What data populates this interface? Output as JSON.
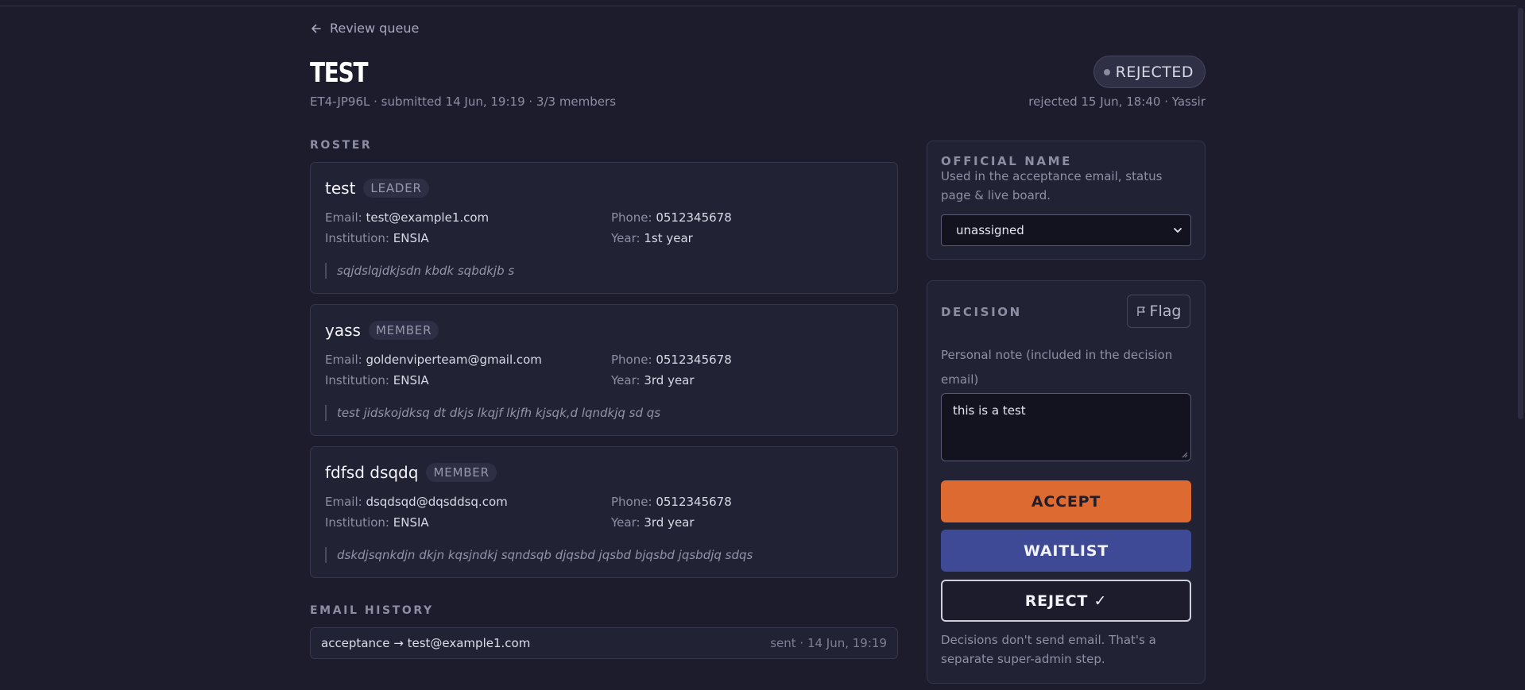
{
  "nav": {
    "back_label": "Review queue"
  },
  "team": {
    "name": "TEST",
    "meta": "ET4-JP96L · submitted 14 Jun, 19:19 · 3/3 members",
    "status": "REJECTED",
    "status_detail": "rejected 15 Jun, 18:40 · Yassir"
  },
  "roster": {
    "label": "ROSTER",
    "members": [
      {
        "name": "test",
        "role": "LEADER",
        "email": "test@example1.com",
        "phone": "0512345678",
        "institution": "ENSIA",
        "year": "1st year",
        "note": "sqjdslqjdkjsdn kbdk sqbdkjb s"
      },
      {
        "name": "yass",
        "role": "MEMBER",
        "email": "goldenviperteam@gmail.com",
        "phone": "0512345678",
        "institution": "ENSIA",
        "year": "3rd year",
        "note": "test jidskojdksq dt dkjs lkqjf lkjfh kjsqk,d lqndkjq sd qs"
      },
      {
        "name": "fdfsd dsqdq",
        "role": "MEMBER",
        "email": "dsqdsqd@dqsddsq.com",
        "phone": "0512345678",
        "institution": "ENSIA",
        "year": "3rd year",
        "note": "dskdjsqnkdjn dkjn kqsjndkj sqndsqb djqsbd jqsbd bjqsbd jqsbdjq sdqs"
      }
    ],
    "labels": {
      "email": "Email:",
      "phone": "Phone:",
      "institution": "Institution:",
      "year": "Year:"
    }
  },
  "email_history": {
    "label": "EMAIL HISTORY",
    "entries": [
      {
        "text": "acceptance → test@example1.com",
        "status": "sent · 14 Jun, 19:19"
      }
    ]
  },
  "official_name": {
    "label": "OFFICIAL NAME",
    "help": "Used in the acceptance email, status page & live board.",
    "selected": "unassigned"
  },
  "decision": {
    "label": "DECISION",
    "flag_label": "Flag",
    "note_label": "Personal note (included in the decision email)",
    "note_value": "this is a test",
    "accept_label": "ACCEPT",
    "waitlist_label": "WAITLIST",
    "reject_label": "REJECT ✓",
    "footer": "Decisions don't send email. That's a separate super-admin step."
  },
  "colors": {
    "accept": "#dd6a30",
    "waitlist": "#3e4a96",
    "background": "#1c1c2d"
  }
}
